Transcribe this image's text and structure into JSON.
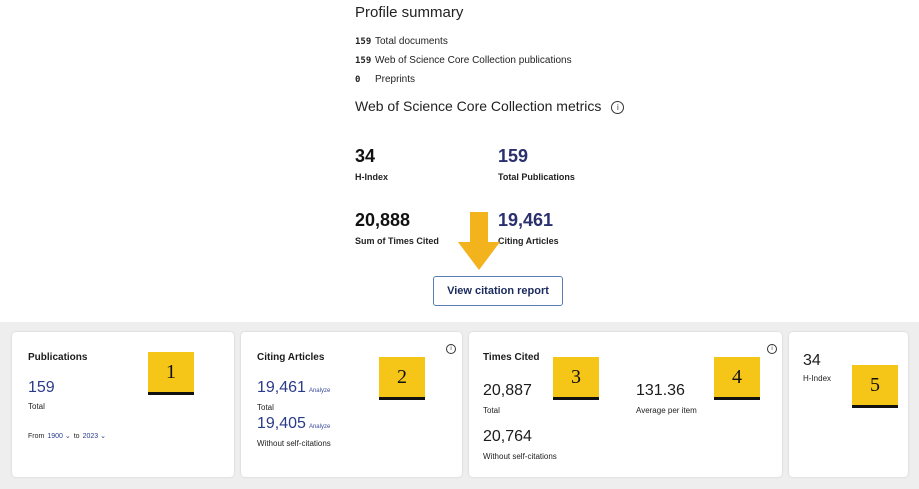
{
  "profile": {
    "title": "Profile summary",
    "docs": [
      {
        "count": "159",
        "label": "Total documents"
      },
      {
        "count": "159",
        "label": "Web of Science Core Collection publications"
      },
      {
        "count": "0",
        "label": "Preprints"
      }
    ]
  },
  "metrics": {
    "title": "Web of Science Core Collection metrics",
    "info": "ⓘ",
    "h_index": {
      "value": "34",
      "label": "H-Index"
    },
    "total_pubs": {
      "value": "159",
      "label": "Total Publications"
    },
    "sum_cited": {
      "value": "20,888",
      "label": "Sum of Times Cited"
    },
    "citing": {
      "value": "19,461",
      "label": "Citing Articles"
    },
    "button": "View citation report"
  },
  "cards": {
    "publications": {
      "title": "Publications",
      "value": "159",
      "value_label": "Total",
      "from_label": "From",
      "from_value": "1900 ⌄",
      "to_label": "to",
      "to_value": "2023 ⌄",
      "badge": "1"
    },
    "citing": {
      "title": "Citing Articles",
      "value": "19,461",
      "analyze": "Analyze",
      "value_label": "Total",
      "value2": "19,405",
      "analyze2": "Analyze",
      "value2_label": "Without self-citations",
      "badge": "2"
    },
    "times_cited": {
      "title": "Times Cited",
      "value": "20,887",
      "value_label": "Total",
      "value2": "20,764",
      "value2_label": "Without self-citations",
      "avg": "131.36",
      "avg_label": "Average per item",
      "badge": "3",
      "badge2": "4"
    },
    "hindex": {
      "value": "34",
      "label": "H-Index",
      "badge": "5"
    }
  },
  "colors": {
    "accent_blue": "#2a3b8a",
    "badge_yellow": "#f5c518",
    "arrow": "#f2b31c"
  }
}
